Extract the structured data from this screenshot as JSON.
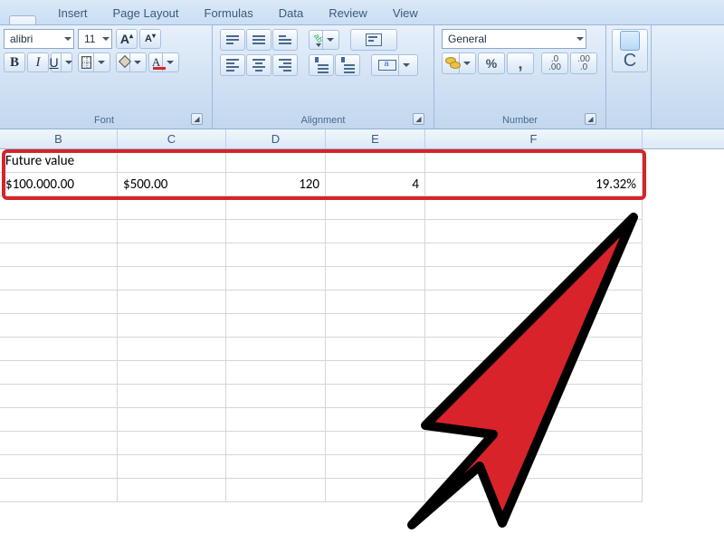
{
  "tabs": {
    "active": "",
    "items": [
      "Insert",
      "Page Layout",
      "Formulas",
      "Data",
      "Review",
      "View"
    ]
  },
  "ribbon": {
    "font": {
      "title": "Font",
      "name": "alibri",
      "size": "11",
      "grow_label": "A",
      "shrink_label": "A",
      "bold": "B",
      "italic": "I",
      "underline": "U",
      "font_color_letter": "A",
      "fill_color": "#ffff00",
      "font_color": "#d8232a"
    },
    "alignment": {
      "title": "Alignment"
    },
    "number": {
      "title": "Number",
      "format": "General",
      "percent": "%",
      "comma": ",",
      "dec_inc_top": ".0",
      "dec_inc_bot": ".00",
      "dec_dec_top": ".00",
      "dec_dec_bot": ".0"
    },
    "edge": {
      "letter": "C"
    }
  },
  "columns": [
    "B",
    "C",
    "D",
    "E",
    "F"
  ],
  "cells": {
    "row1": {
      "B": "Future value",
      "C": "",
      "D": "",
      "E": "",
      "F": ""
    },
    "row2": {
      "B": "$100.000.00",
      "C": "$500.00",
      "D": "120",
      "E": "4",
      "F": "19.32%"
    }
  }
}
